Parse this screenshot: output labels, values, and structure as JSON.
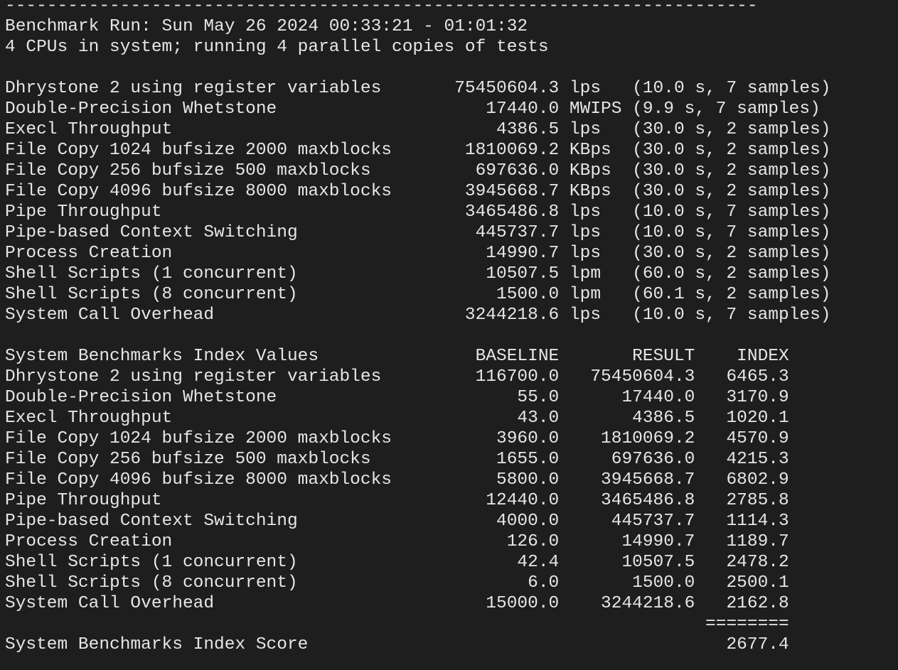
{
  "terminal": {
    "lines": [
      "------------------------------------------------------------------------",
      "Benchmark Run: Sun May 26 2024 00:33:21 - 01:01:32",
      "4 CPUs in system; running 4 parallel copies of tests",
      "",
      "Dhrystone 2 using register variables       75450604.3 lps   (10.0 s, 7 samples)",
      "Double-Precision Whetstone                    17440.0 MWIPS (9.9 s, 7 samples)",
      "Execl Throughput                               4386.5 lps   (30.0 s, 2 samples)",
      "File Copy 1024 bufsize 2000 maxblocks       1810069.2 KBps  (30.0 s, 2 samples)",
      "File Copy 256 bufsize 500 maxblocks          697636.0 KBps  (30.0 s, 2 samples)",
      "File Copy 4096 bufsize 8000 maxblocks       3945668.7 KBps  (30.0 s, 2 samples)",
      "Pipe Throughput                             3465486.8 lps   (10.0 s, 7 samples)",
      "Pipe-based Context Switching                 445737.7 lps   (10.0 s, 7 samples)",
      "Process Creation                              14990.7 lps   (30.0 s, 2 samples)",
      "Shell Scripts (1 concurrent)                  10507.5 lpm   (60.0 s, 2 samples)",
      "Shell Scripts (8 concurrent)                   1500.0 lpm   (60.1 s, 2 samples)",
      "System Call Overhead                        3244218.6 lps   (10.0 s, 7 samples)",
      "",
      "System Benchmarks Index Values               BASELINE       RESULT    INDEX",
      "Dhrystone 2 using register variables         116700.0   75450604.3   6465.3",
      "Double-Precision Whetstone                       55.0      17440.0   3170.9",
      "Execl Throughput                                 43.0       4386.5   1020.1",
      "File Copy 1024 bufsize 2000 maxblocks          3960.0    1810069.2   4570.9",
      "File Copy 256 bufsize 500 maxblocks            1655.0     697636.0   4215.3",
      "File Copy 4096 bufsize 8000 maxblocks          5800.0    3945668.7   6802.9",
      "Pipe Throughput                               12440.0    3465486.8   2785.8",
      "Pipe-based Context Switching                   4000.0     445737.7   1114.3",
      "Process Creation                                126.0      14990.7   1189.7",
      "Shell Scripts (1 concurrent)                     42.4      10507.5   2478.2",
      "Shell Scripts (8 concurrent)                      6.0       1500.0   2500.1",
      "System Call Overhead                          15000.0    3244218.6   2162.8",
      "                                                                   ========",
      "System Benchmarks Index Score                                        2677.4"
    ]
  },
  "colors": {
    "background": "#1e1e1e",
    "foreground": "#e6e6e6"
  }
}
